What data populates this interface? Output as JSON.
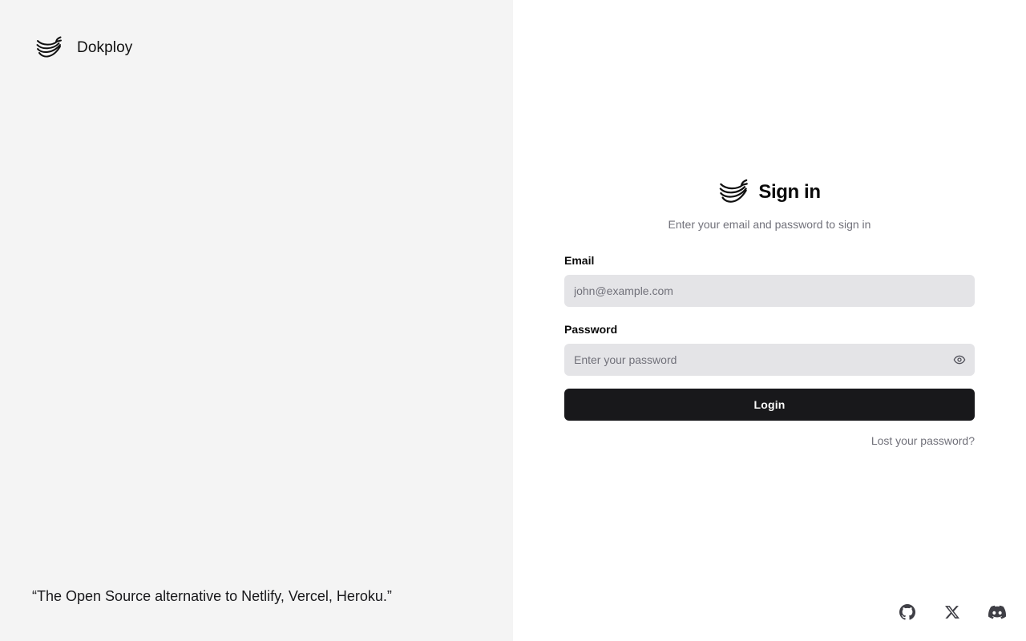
{
  "brand": {
    "name": "Dokploy",
    "logo_icon": "dokploy-whale-logo"
  },
  "quote": "“The Open Source alternative to Netlify, Vercel, Heroku.”",
  "signin": {
    "title": "Sign in",
    "subtitle": "Enter your email and password to sign in",
    "email": {
      "label": "Email",
      "value": "",
      "placeholder": "john@example.com"
    },
    "password": {
      "label": "Password",
      "value": "",
      "placeholder": "Enter your password",
      "toggle_icon": "eye-icon"
    },
    "login_label": "Login",
    "lost_password": "Lost your password?"
  },
  "socials": [
    {
      "icon": "github-icon"
    },
    {
      "icon": "x-icon"
    },
    {
      "icon": "discord-icon"
    }
  ],
  "colors": {
    "left_panel_bg": "#f4f4f4",
    "input_bg": "#e4e4e7",
    "button_bg": "#18181b",
    "muted_text": "#71717a"
  }
}
